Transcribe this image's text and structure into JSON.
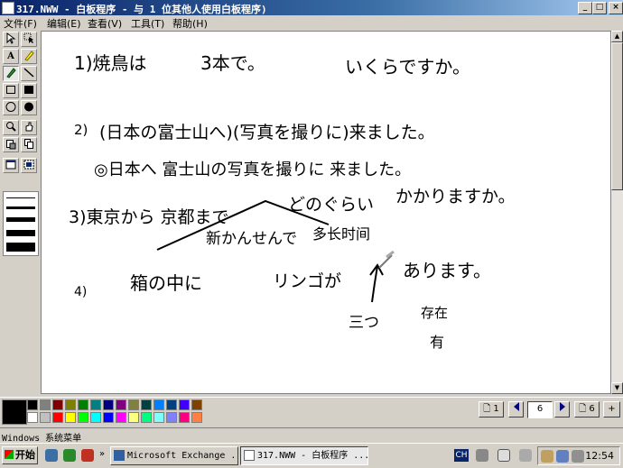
{
  "window": {
    "title": "317.NWW - 白板程序 - 与 1 位其他人使用白板程序)",
    "buttons": [
      "_",
      "□",
      "×"
    ]
  },
  "menu": [
    "文件(F)",
    "编辑(E)",
    "查看(V)",
    "工具(T)",
    "帮助(H)"
  ],
  "toolbox": {
    "tools": [
      "select-arrow",
      "select-area",
      "text",
      "highlighter",
      "pen",
      "line",
      "rect-outline",
      "rect-filled",
      "ellipse-outline",
      "ellipse-filled",
      "zoom",
      "remote-pointer",
      "eraser",
      "lock",
      "select-window",
      "capture-area"
    ],
    "text_tool_label": "A"
  },
  "handwriting": {
    "q1": [
      "1)焼鳥は",
      "3本で。",
      "いくらですか。"
    ],
    "q2": [
      "2)",
      "(日本の富士山へ)(写真を撮りに)来ました。",
      "◎日本へ 富士山の写真を撮りに 来ました。"
    ],
    "q3": [
      "3)東京から 京都まで",
      "どのぐらい",
      "かかりますか。",
      "新かんせんで",
      "多长时间"
    ],
    "q4": [
      "4)",
      "箱の中に",
      "リンゴが",
      "あります。",
      "三つ",
      "存在",
      "有"
    ]
  },
  "palette": {
    "colors": [
      "#000000",
      "#808080",
      "#800000",
      "#808000",
      "#008000",
      "#008080",
      "#000080",
      "#800080",
      "#808040",
      "#004040",
      "#0080ff",
      "#004080",
      "#4000ff",
      "#804000",
      "#ffffff",
      "#c0c0c0",
      "#ff0000",
      "#ffff00",
      "#00ff00",
      "#00ffff",
      "#0000ff",
      "#ff00ff",
      "#ffff80",
      "#00ff80",
      "#80ffff",
      "#8080ff",
      "#ff0080",
      "#ff8040"
    ],
    "current_color": "#000000"
  },
  "pagenav": {
    "first_label": "1",
    "current_page": "6",
    "last_label": "6",
    "add_label": "+"
  },
  "status": "Windows 系统菜单",
  "taskbar": {
    "start": "开始",
    "tasks": [
      "Microsoft Exchange ...",
      "317.NWW - 白板程序 ..."
    ],
    "lang": "CH",
    "clock": "12:54"
  }
}
